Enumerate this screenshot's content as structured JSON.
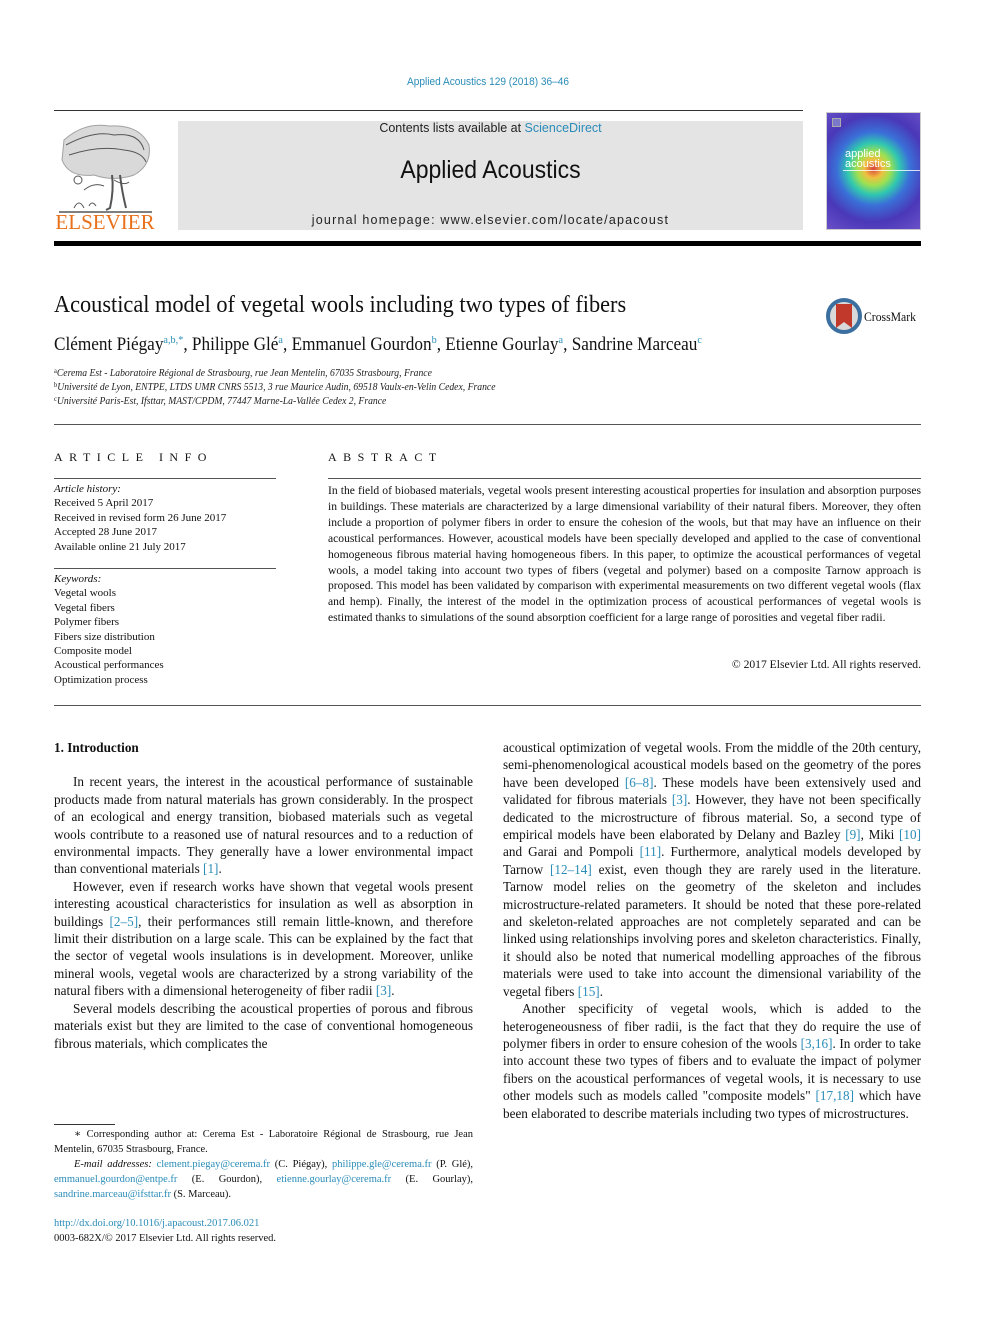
{
  "header": {
    "citation": "Applied Acoustics 129 (2018) 36–46",
    "contents_prefix": "Contents lists available at ",
    "contents_link": "ScienceDirect",
    "journal_name": "Applied Acoustics",
    "homepage": "journal homepage: www.elsevier.com/locate/apacoust",
    "publisher_logo_text": "ELSEVIER",
    "cover_title_line1": "applied",
    "cover_title_line2": "acoustics",
    "colors": {
      "link": "#2a8cb8",
      "elsevier_orange": "#e9711c",
      "header_box": "#e4e4e4"
    }
  },
  "article": {
    "title": "Acoustical model of vegetal wools including two types of fibers",
    "crossmark_label": "CrossMark",
    "authors": [
      {
        "name": "Clément Piégay",
        "sup": "a,b,",
        "star": "*"
      },
      {
        "name": "Philippe Glé",
        "sup": "a"
      },
      {
        "name": "Emmanuel Gourdon",
        "sup": "b"
      },
      {
        "name": "Etienne Gourlay",
        "sup": "a"
      },
      {
        "name": "Sandrine Marceau",
        "sup": "c"
      }
    ],
    "affiliations": [
      {
        "mark": "a",
        "text": "Cerema Est - Laboratoire Régional de Strasbourg, rue Jean Mentelin, 67035 Strasbourg, France"
      },
      {
        "mark": "b",
        "text": "Université de Lyon, ENTPE, LTDS UMR CNRS 5513, 3 rue Maurice Audin, 69518 Vaulx-en-Velin Cedex, France"
      },
      {
        "mark": "c",
        "text": "Université Paris-Est, Ifsttar, MAST/CPDM, 77447 Marne-La-Vallée Cedex 2, France"
      }
    ]
  },
  "article_info": {
    "heading": "ARTICLE INFO",
    "history_label": "Article history:",
    "history": [
      "Received 5 April 2017",
      "Received in revised form 26 June 2017",
      "Accepted 28 June 2017",
      "Available online 21 July 2017"
    ],
    "keywords_label": "Keywords:",
    "keywords": [
      "Vegetal wools",
      "Vegetal fibers",
      "Polymer fibers",
      "Fibers size distribution",
      "Composite model",
      "Acoustical performances",
      "Optimization process"
    ]
  },
  "abstract": {
    "heading": "ABSTRACT",
    "text": "In the field of biobased materials, vegetal wools present interesting acoustical properties for insulation and absorption purposes in buildings. These materials are characterized by a large dimensional variability of their natural fibers. Moreover, they often include a proportion of polymer fibers in order to ensure the cohesion of the wools, but that may have an influence on their acoustical performances. However, acoustical models have been specially developed and applied to the case of conventional homogeneous fibrous material having homogeneous fibers. In this paper, to optimize the acoustical performances of vegetal wools, a model taking into account two types of fibers (vegetal and polymer) based on a composite Tarnow approach is proposed. This model has been validated by comparison with experimental measurements on two different vegetal wools (flax and hemp). Finally, the interest of the model in the optimization process of acoustical performances of vegetal wools is estimated thanks to simulations of the sound absorption coefficient for a large range of porosities and vegetal fiber radii.",
    "copyright": "© 2017 Elsevier Ltd. All rights reserved."
  },
  "body": {
    "section_heading": "1. Introduction",
    "left_paragraphs": [
      {
        "parts": [
          {
            "t": "In recent years, the interest in the acoustical performance of sustainable products made from natural materials has grown considerably. In the prospect of an ecological and energy transition, biobased materials such as vegetal wools contribute to a reasoned use of natural resources and to a reduction of environmental impacts. They generally have a lower environmental impact than conventional materials "
          },
          {
            "ref": "[1]"
          },
          {
            "t": "."
          }
        ]
      },
      {
        "parts": [
          {
            "t": "However, even if research works have shown that vegetal wools present interesting acoustical characteristics for insulation as well as absorption in buildings "
          },
          {
            "ref": "[2–5]"
          },
          {
            "t": ", their performances still remain little-known, and therefore limit their distribution on a large scale. This can be explained by the fact that the sector of vegetal wools insulations is in development. Moreover, unlike mineral wools, vegetal wools are characterized by a strong variability of the natural fibers with a dimensional heterogeneity of fiber radii "
          },
          {
            "ref": "[3]"
          },
          {
            "t": "."
          }
        ]
      },
      {
        "parts": [
          {
            "t": "Several models describing the acoustical properties of porous and fibrous materials exist but they are limited to the case of conventional homogeneous fibrous materials, which complicates the"
          }
        ]
      }
    ],
    "right_paragraphs": [
      {
        "noindent": true,
        "parts": [
          {
            "t": "acoustical optimization of vegetal wools. From the middle of the 20th century, semi-phenomenological acoustical models based on the geometry of the pores have been developed "
          },
          {
            "ref": "[6–8]"
          },
          {
            "t": ". These models have been extensively used and validated for fibrous materials "
          },
          {
            "ref": "[3]"
          },
          {
            "t": ". However, they have not been specifically dedicated to the microstructure of fibrous material. So, a second type of empirical models have been elaborated by Delany and Bazley "
          },
          {
            "ref": "[9]"
          },
          {
            "t": ", Miki "
          },
          {
            "ref": "[10]"
          },
          {
            "t": " and Garai and Pompoli "
          },
          {
            "ref": "[11]"
          },
          {
            "t": ". Furthermore, analytical models developed by Tarnow "
          },
          {
            "ref": "[12–14]"
          },
          {
            "t": " exist, even though they are rarely used in the literature. Tarnow model relies on the geometry of the skeleton and includes microstructure-related parameters. It should be noted that these pore-related and skeleton-related approaches are not completely separated and can be linked using relationships involving pores and skeleton characteristics. Finally, it should also be noted that numerical modelling approaches of the fibrous materials were used to take into account the dimensional variability of the vegetal fibers "
          },
          {
            "ref": "[15]"
          },
          {
            "t": "."
          }
        ]
      },
      {
        "parts": [
          {
            "t": "Another specificity of vegetal wools, which is added to the heterogeneousness of fiber radii, is the fact that they do require the use of polymer fibers in order to ensure cohesion of the wools "
          },
          {
            "ref": "[3,16]"
          },
          {
            "t": ". In order to take into account these two types of fibers and to evaluate the impact of polymer fibers on the acoustical performances of vegetal wools, it is necessary to use other models such as models called \"composite models\" "
          },
          {
            "ref": "[17,18]"
          },
          {
            "t": " which have been elaborated to describe materials including two types of microstructures."
          }
        ]
      }
    ]
  },
  "footnotes": {
    "corresponding": "∗ Corresponding author at: Cerema Est - Laboratoire Régional de Strasbourg, rue Jean Mentelin, 67035 Strasbourg, France.",
    "email_label": "E-mail addresses:",
    "emails": [
      {
        "addr": "clement.piegay@cerema.fr",
        "who": "(C. Piégay)"
      },
      {
        "addr": "philippe.gle@cerema.fr",
        "who": "(P. Glé)"
      },
      {
        "addr": "emmanuel.gourdon@entpe.fr",
        "who": "(E. Gourdon)"
      },
      {
        "addr": "etienne.gourlay@cerema.fr",
        "who": "(E. Gourlay)"
      },
      {
        "addr": "sandrine.marceau@ifsttar.fr",
        "who": "(S. Marceau)."
      }
    ],
    "doi": "http://dx.doi.org/10.1016/j.apacoust.2017.06.021",
    "issn_copyright": "0003-682X/© 2017 Elsevier Ltd. All rights reserved."
  }
}
